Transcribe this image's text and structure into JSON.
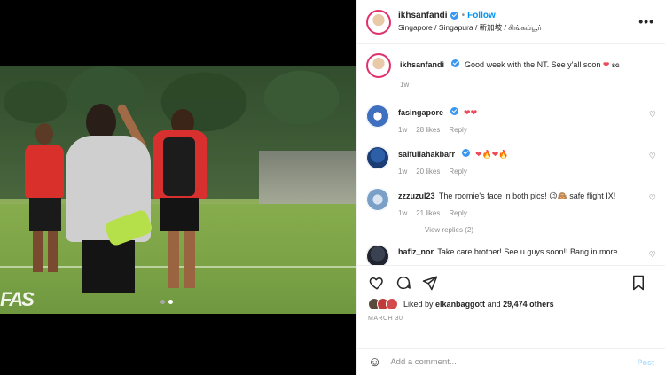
{
  "colors": {
    "accent": "#0095f6",
    "verified": "#3897f0",
    "heart": "#ed4956",
    "muted": "#8e8e8e",
    "post_disabled": "#b2dffc"
  },
  "media": {
    "logo_text": "FAS",
    "carousel": {
      "count": 2,
      "active_index": 1
    }
  },
  "header": {
    "username": "ikhsanfandi",
    "verified": true,
    "separator": "•",
    "follow_label": "Follow",
    "location": "Singapore / Singapura / 新加坡 / சிங்கப்பூர்",
    "more_icon": "more-options-icon"
  },
  "caption": {
    "username": "ikhsanfandi",
    "text": "Good week with the NT. See y'all soon",
    "heart": "❤",
    "flag": "SG",
    "time": "1w"
  },
  "comments": [
    {
      "username": "fasingapore",
      "text": "",
      "emoji": "❤❤",
      "time": "1w",
      "likes": "28 likes",
      "reply": "Reply"
    },
    {
      "username": "saifullahakbarr",
      "text": "",
      "emoji": "❤🔥❤🔥",
      "time": "1w",
      "likes": "20 likes",
      "reply": "Reply"
    },
    {
      "username": "zzzuzul23",
      "text": "The roomie's face in both pics! 😉🙈 safe flight IX!",
      "time": "1w",
      "likes": "21 likes",
      "reply": "Reply",
      "view_replies": "View replies (2)"
    },
    {
      "username": "hafiz_nor",
      "text": "Take care brother! See u guys soon!! Bang in more"
    }
  ],
  "actions": {
    "liked_by_prefix": "Liked by",
    "liked_by_user": "elkanbaggott",
    "liked_by_connector": "and",
    "others": "29,474 others",
    "date": "MARCH 30"
  },
  "add_comment": {
    "placeholder": "Add a comment...",
    "post_label": "Post"
  }
}
